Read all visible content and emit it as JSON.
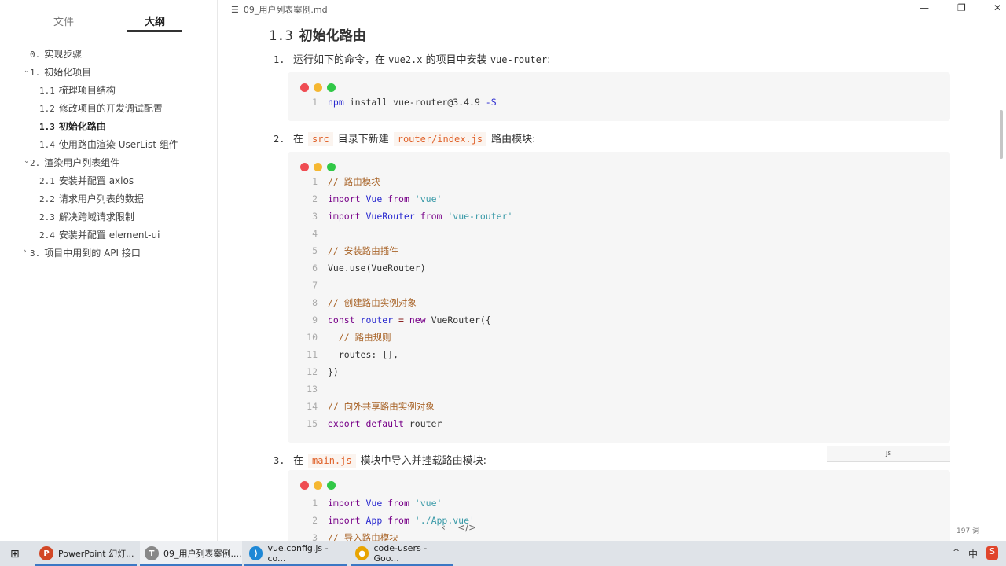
{
  "sidebar": {
    "tabs": [
      "文件",
      "大纲"
    ],
    "outline": [
      {
        "num": "0.",
        "label": "实现步骤"
      },
      {
        "num": "1.",
        "label": "初始化项目"
      },
      {
        "num": "1.1",
        "label": "梳理项目结构"
      },
      {
        "num": "1.2",
        "label": "修改项目的开发调试配置"
      },
      {
        "num": "1.3",
        "label": "初始化路由"
      },
      {
        "num": "1.4",
        "label": "使用路由渲染 UserList 组件"
      },
      {
        "num": "2.",
        "label": "渲染用户列表组件"
      },
      {
        "num": "2.1",
        "label": "安装并配置 axios"
      },
      {
        "num": "2.2",
        "label": "请求用户列表的数据"
      },
      {
        "num": "2.3",
        "label": "解决跨域请求限制"
      },
      {
        "num": "2.4",
        "label": "安装并配置 element-ui"
      },
      {
        "num": "3.",
        "label": "项目中用到的 API 接口"
      }
    ]
  },
  "doc": {
    "file_title": "09_用户列表案例.md",
    "heading_num": "1.3",
    "heading": "初始化路由",
    "step1": {
      "n": "1.",
      "a": "运行如下的命令，在",
      "code": "vue2.x",
      "b": "的项目中安装",
      "code2": "vue-router",
      "c": ":"
    },
    "step2": {
      "n": "2.",
      "a": "在",
      "code": "src",
      "b": "目录下新建",
      "code2": "router/index.js",
      "c": "路由模块:"
    },
    "step3": {
      "n": "3.",
      "a": "在",
      "code": "main.js",
      "b": "模块中导入并挂载路由模块:"
    },
    "lang_label": "js",
    "word_count": "197 词"
  },
  "code_blocks": [
    [
      [
        [
          "npm ",
          "id"
        ],
        [
          "install vue-router@3.4.9 ",
          "tx"
        ],
        [
          "-S",
          "id"
        ]
      ]
    ],
    [
      [
        [
          "// 路由模块",
          "cm"
        ]
      ],
      [
        [
          "import ",
          "kw"
        ],
        [
          "Vue ",
          "id"
        ],
        [
          "from ",
          "kw"
        ],
        [
          "'vue'",
          "st"
        ]
      ],
      [
        [
          "import ",
          "kw"
        ],
        [
          "VueRouter ",
          "id"
        ],
        [
          "from ",
          "kw"
        ],
        [
          "'vue-router'",
          "st"
        ]
      ],
      [],
      [
        [
          "// 安装路由插件",
          "cm"
        ]
      ],
      [
        [
          "Vue.use(VueRouter)",
          "tx"
        ]
      ],
      [],
      [
        [
          "// 创建路由实例对象",
          "cm"
        ]
      ],
      [
        [
          "const ",
          "kw"
        ],
        [
          "router ",
          "id"
        ],
        [
          "= ",
          "op"
        ],
        [
          "new ",
          "kw"
        ],
        [
          "VueRouter({",
          "tx"
        ]
      ],
      [
        [
          "  // 路由规则",
          "cm"
        ]
      ],
      [
        [
          "  routes: [],",
          "tx"
        ]
      ],
      [
        [
          "})",
          "tx"
        ]
      ],
      [],
      [
        [
          "// 向外共享路由实例对象",
          "cm"
        ]
      ],
      [
        [
          "export ",
          "kw"
        ],
        [
          "default ",
          "kw"
        ],
        [
          "router",
          "tx"
        ]
      ]
    ],
    [
      [
        [
          "import ",
          "kw"
        ],
        [
          "Vue ",
          "id"
        ],
        [
          "from ",
          "kw"
        ],
        [
          "'vue'",
          "st"
        ]
      ],
      [
        [
          "import ",
          "kw"
        ],
        [
          "App ",
          "id"
        ],
        [
          "from ",
          "kw"
        ],
        [
          "'./App.vue'",
          "st"
        ]
      ],
      [
        [
          "// 导入路由模块",
          "cm"
        ]
      ]
    ]
  ],
  "taskbar": [
    {
      "label": "PowerPoint 幻灯...",
      "color": "#d24726",
      "glyph": "P"
    },
    {
      "label": "09_用户列表案例....",
      "color": "#888",
      "glyph": "T"
    },
    {
      "label": "vue.config.js - co...",
      "color": "#1e88d6",
      "glyph": "⟩"
    },
    {
      "label": "code-users - Goo...",
      "color": "#e8a400",
      "glyph": "●"
    }
  ],
  "tray": {
    "ime": "中",
    "chevron": "^"
  },
  "colors": {
    "red": "#ef4c52",
    "yellow": "#f5b731",
    "green": "#31c847"
  }
}
